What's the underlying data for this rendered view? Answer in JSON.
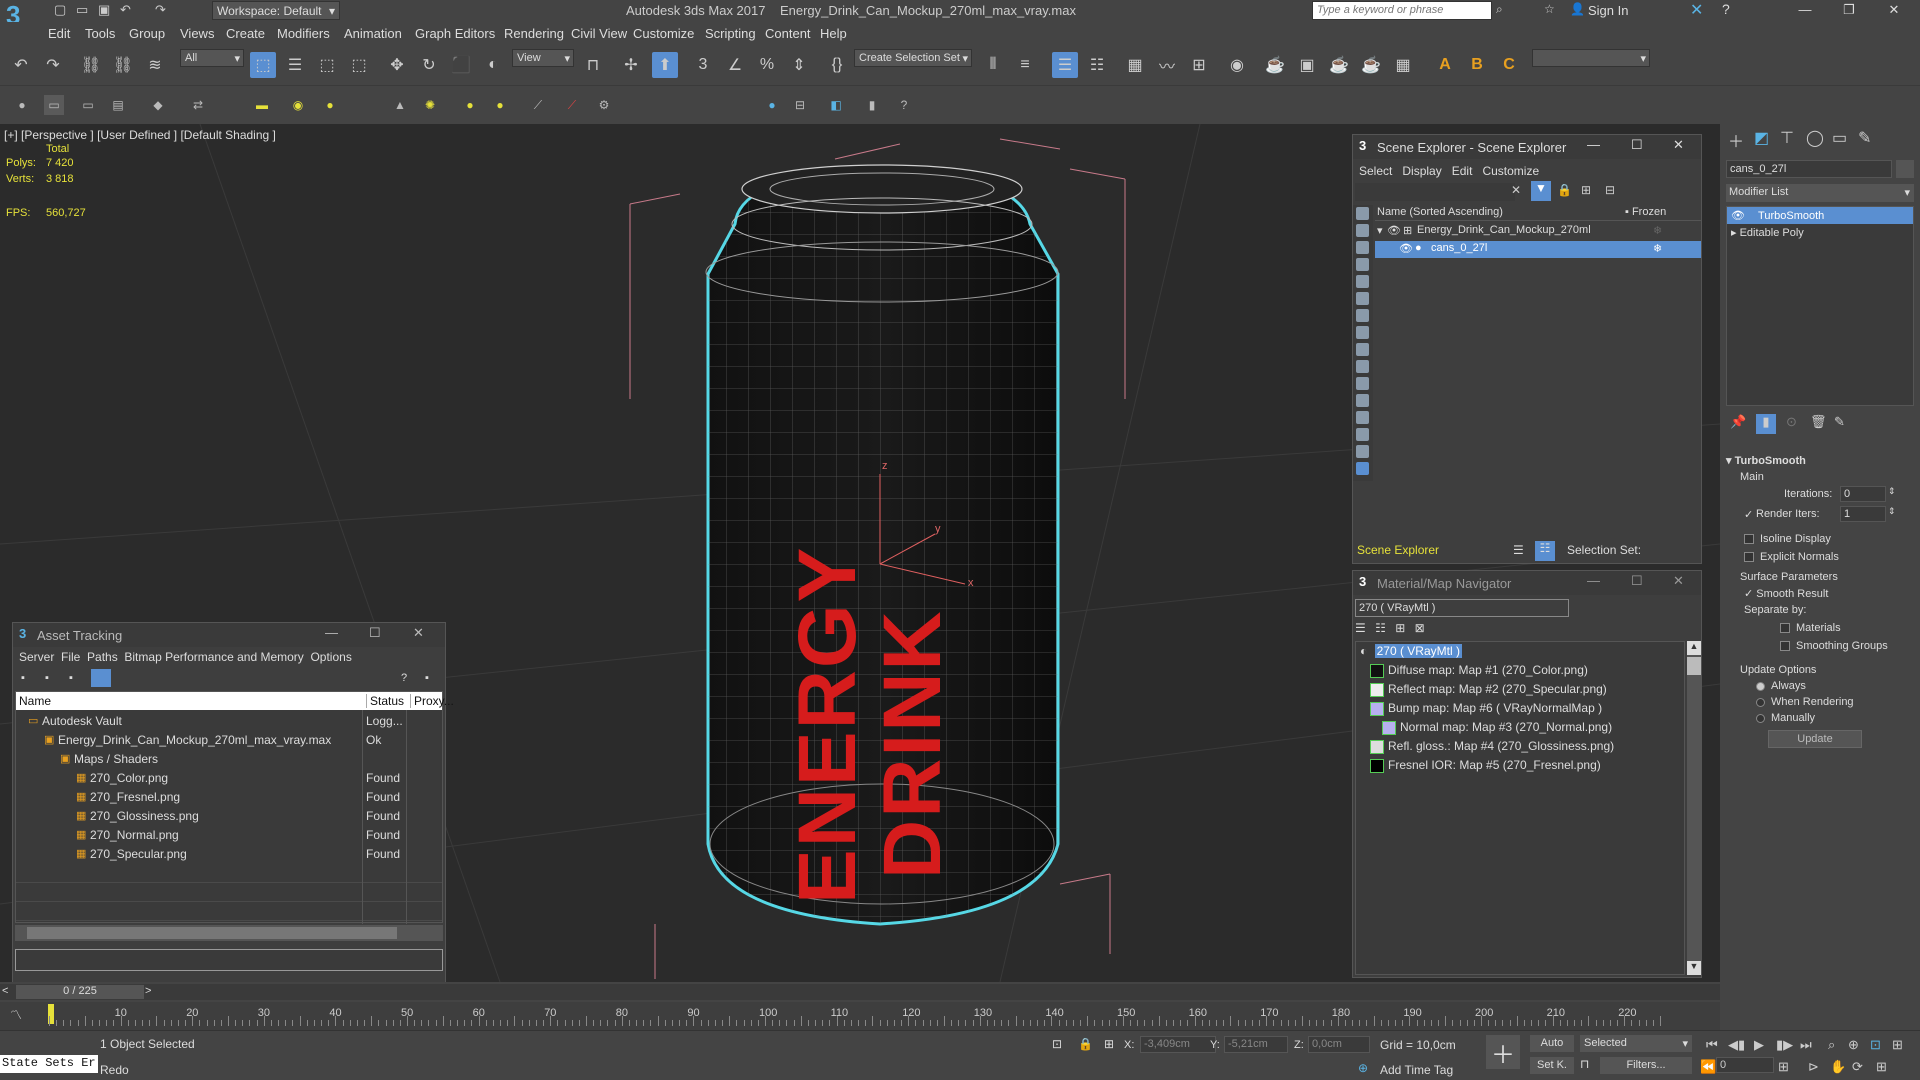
{
  "app": {
    "title": "Autodesk 3ds Max 2017",
    "file": "Energy_Drink_Can_Mockup_270ml_max_vray.max",
    "workspace": "Workspace: Default",
    "search_placeholder": "Type a keyword or phrase",
    "sign_in": "Sign In"
  },
  "menu": [
    "Edit",
    "Tools",
    "Group",
    "Views",
    "Create",
    "Modifiers",
    "Animation",
    "Graph Editors",
    "Rendering",
    "Civil View",
    "Customize",
    "Scripting",
    "Content",
    "Help"
  ],
  "toolbar": {
    "filter": "All",
    "view": "View",
    "selection_set": "Create Selection Set"
  },
  "viewport": {
    "label_plus": "[+]",
    "label_view": "[Perspective ]",
    "label_user": "[User Defined ]",
    "label_shading": "[Default Shading ]",
    "stats_total": "Total",
    "polys_label": "Polys:",
    "polys_value": "7 420",
    "verts_label": "Verts:",
    "verts_value": "3 818",
    "fps_label": "FPS:",
    "fps_value": "560,727",
    "can_text_1": "ENERGY",
    "can_text_2": "DRINK",
    "axis_x": "x",
    "axis_y": "y",
    "axis_z": "z"
  },
  "scene_explorer": {
    "title": "Scene Explorer - Scene Explorer",
    "menu": [
      "Select",
      "Display",
      "Edit",
      "Customize"
    ],
    "col_name": "Name (Sorted Ascending)",
    "col_frozen": "▪ Frozen",
    "items": [
      {
        "name": "Energy_Drink_Can_Mockup_270ml"
      },
      {
        "name": "cans_0_27l"
      }
    ],
    "footer_label": "Scene Explorer",
    "selection_set": "Selection Set:"
  },
  "material_nav": {
    "title": "Material/Map Navigator",
    "current": "270  ( VRayMtl )",
    "root": "270  ( VRayMtl )",
    "maps": [
      "Diffuse map: Map #1 (270_Color.png)",
      "Reflect map: Map #2 (270_Specular.png)",
      "Bump map: Map #6  ( VRayNormalMap )",
      "Normal map: Map #3 (270_Normal.png)",
      "Refl. gloss.: Map #4 (270_Glossiness.png)",
      "Fresnel IOR: Map #5 (270_Fresnel.png)"
    ]
  },
  "asset_tracking": {
    "title": "Asset Tracking",
    "menu": [
      "Server",
      "File",
      "Paths",
      "Bitmap Performance and Memory",
      "Options"
    ],
    "col_name": "Name",
    "col_status": "Status",
    "col_proxy": "Proxy...",
    "rows": [
      {
        "name": "Autodesk Vault",
        "status": "Logg...",
        "indent": 0
      },
      {
        "name": "Energy_Drink_Can_Mockup_270ml_max_vray.max",
        "status": "Ok",
        "indent": 1
      },
      {
        "name": "Maps / Shaders",
        "status": "",
        "indent": 2
      },
      {
        "name": "270_Color.png",
        "status": "Found",
        "indent": 3
      },
      {
        "name": "270_Fresnel.png",
        "status": "Found",
        "indent": 3
      },
      {
        "name": "270_Glossiness.png",
        "status": "Found",
        "indent": 3
      },
      {
        "name": "270_Normal.png",
        "status": "Found",
        "indent": 3
      },
      {
        "name": "270_Specular.png",
        "status": "Found",
        "indent": 3
      }
    ]
  },
  "command_panel": {
    "object_name": "cans_0_27l",
    "modifier_list": "Modifier List",
    "stack": [
      "TurboSmooth",
      "Editable Poly"
    ],
    "rollout": "TurboSmooth",
    "main": "Main",
    "iterations_label": "Iterations:",
    "iterations_value": "0",
    "render_iters_label": "Render Iters:",
    "render_iters_value": "1",
    "isoline": "Isoline Display",
    "explicit_normals": "Explicit Normals",
    "surface_params": "Surface Parameters",
    "smooth_result": "Smooth Result",
    "separate_by": "Separate by:",
    "materials": "Materials",
    "smoothing_groups": "Smoothing Groups",
    "update_options": "Update Options",
    "always": "Always",
    "when_rendering": "When Rendering",
    "manually": "Manually",
    "update_btn": "Update"
  },
  "timeline": {
    "frame": "0 / 225",
    "ticks": [
      "0",
      "10",
      "20",
      "30",
      "40",
      "50",
      "60",
      "70",
      "80",
      "90",
      "100",
      "110",
      "120",
      "130",
      "140",
      "150",
      "160",
      "170",
      "180",
      "190",
      "200",
      "210",
      "220"
    ]
  },
  "status": {
    "selected": "1 Object Selected",
    "redo": "Redo",
    "state_sets": "State Sets Er",
    "x_label": "X:",
    "x_value": "-3,409cm",
    "y_label": "Y:",
    "y_value": "-5,21cm",
    "z_label": "Z:",
    "z_value": "0,0cm",
    "grid": "Grid = 10,0cm",
    "add_time_tag": "Add Time Tag",
    "auto": "Auto",
    "set_k": "Set K.",
    "selected_dd": "Selected",
    "filters": "Filters...",
    "frame_field": "0"
  }
}
